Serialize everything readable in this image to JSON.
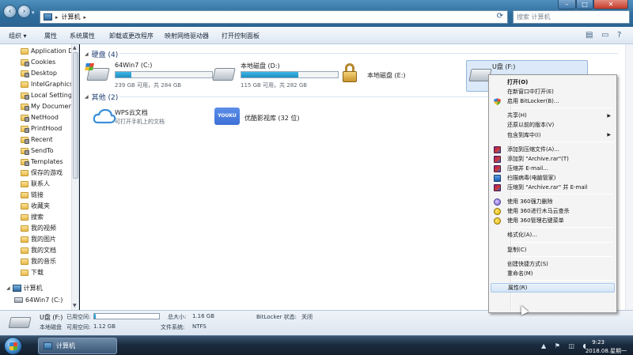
{
  "address": {
    "computer_label": "计算机"
  },
  "search": {
    "placeholder": "搜索 计算机"
  },
  "toolbar": {
    "items": [
      "组织",
      "属性",
      "系统属性",
      "卸载或更改程序",
      "映射网络驱动器",
      "打开控制面板"
    ]
  },
  "sidebar": {
    "items": [
      "Application D",
      "Cookies",
      "Desktop",
      "IntelGraphicsP",
      "Local Settings",
      "My Document",
      "NetHood",
      "PrintHood",
      "Recent",
      "SendTo",
      "Templates",
      "保存的游戏",
      "联系人",
      "链接",
      "收藏夹",
      "搜索",
      "我的视频",
      "我的图片",
      "我的文档",
      "我的音乐",
      "下载"
    ],
    "computer": "计算机",
    "drive_c": "64Win7 (C:)"
  },
  "groups": {
    "hard_disks": "硬盘 (4)",
    "other": "其他 (2)"
  },
  "drives": [
    {
      "name": "64Win7 (C:)",
      "size": "239 GB 可用，共 284 GB",
      "used_fraction": 0.16
    },
    {
      "name": "本地磁盘 (D:)",
      "size": "115 GB 可用，共 282 GB",
      "used_fraction": 0.59
    },
    {
      "name": "本地磁盘 (E:)"
    },
    {
      "name": "U盘 (F:)"
    }
  ],
  "others": [
    {
      "name": "WPS云文档",
      "sub": "可打开手机上的文档"
    },
    {
      "name": "优酷影视库 (32 位)"
    }
  ],
  "youku_logo": "YOUKU",
  "context_menu": {
    "items": [
      {
        "label": "打开(O)",
        "bold": true
      },
      {
        "label": "在新窗口中打开(E)"
      },
      {
        "label": "启用 BitLocker(B)...",
        "icon": "bitlocker-shield-icon"
      },
      {
        "sep": true
      },
      {
        "label": "共享(H)",
        "submenu": true
      },
      {
        "label": "还原以前的版本(V)"
      },
      {
        "label": "包含到库中(I)",
        "submenu": true
      },
      {
        "sep": true
      },
      {
        "label": "添加到压缩文件(A)...",
        "icon": "winrar-icon"
      },
      {
        "label": "添加到 \"Archive.rar\"(T)",
        "icon": "winrar-icon"
      },
      {
        "label": "压缩并 E-mail...",
        "icon": "winrar-icon"
      },
      {
        "label": "扫描病毒(电脑管家)",
        "icon": "scan-icon"
      },
      {
        "label": "压缩到 \"Archive.rar\" 并 E-mail",
        "icon": "winrar-icon"
      },
      {
        "sep": true
      },
      {
        "label": "使用 360强力删除",
        "icon": "360-shred-icon"
      },
      {
        "label": "使用 360进行木马云查杀",
        "icon": "360-icon"
      },
      {
        "label": "使用 360管理右键菜单",
        "icon": "360-icon"
      },
      {
        "sep": true
      },
      {
        "label": "格式化(A)..."
      },
      {
        "sep": true
      },
      {
        "label": "复制(C)"
      },
      {
        "sep": true
      },
      {
        "label": "创建快捷方式(S)"
      },
      {
        "label": "重命名(M)"
      },
      {
        "sep": true
      },
      {
        "label": "属性(R)",
        "highlight": true
      }
    ]
  },
  "details": {
    "name": "U盘 (F:)",
    "used_label": "已用空间:",
    "type": "本地磁盘",
    "free_label": "可用空间:",
    "free": "1.12 GB",
    "total_label": "总大小:",
    "total": "1.16 GB",
    "fs_label": "文件系统:",
    "fs": "NTFS",
    "bitlocker_label": "BitLocker 状态:",
    "bitlocker": "关闭",
    "used_fraction": 0.03
  },
  "taskbar": {
    "window_label": "计算机",
    "time": "9:23",
    "date": "2018.08.星期一",
    "tray_icons": "▲ ⚑ ◫ ◖"
  }
}
